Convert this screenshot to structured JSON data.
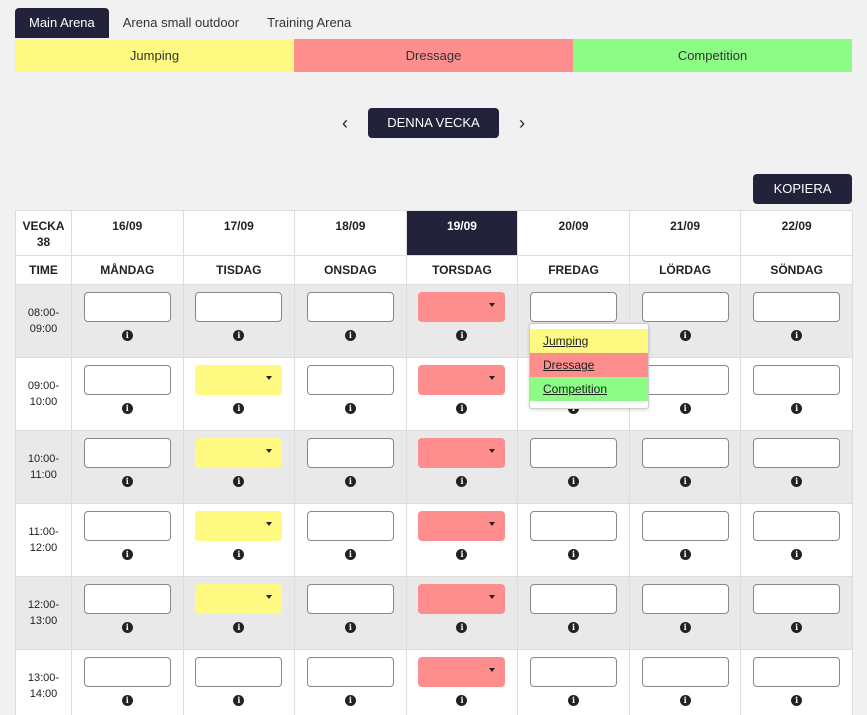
{
  "tabs": [
    {
      "label": "Main Arena",
      "active": true
    },
    {
      "label": "Arena small outdoor",
      "active": false
    },
    {
      "label": "Training Arena",
      "active": false
    }
  ],
  "legend": [
    {
      "label": "Jumping",
      "color": "#fef981"
    },
    {
      "label": "Dressage",
      "color": "#fe8d8d"
    },
    {
      "label": "Competition",
      "color": "#8cfc87"
    }
  ],
  "nav": {
    "prev_icon": "chevron-left-icon",
    "next_icon": "chevron-right-icon",
    "week_label": "DENNA VECKA"
  },
  "copy_label": "KOPIERA",
  "schedule": {
    "week_label_line1": "VECKA",
    "week_number": "38",
    "time_header": "TIME",
    "dates": [
      "16/09",
      "17/09",
      "18/09",
      "19/09",
      "20/09",
      "21/09",
      "22/09"
    ],
    "today_index": 3,
    "days": [
      "MÅNDAG",
      "TISDAG",
      "ONSDAG",
      "TORSDAG",
      "FREDAG",
      "LÖRDAG",
      "SÖNDAG"
    ],
    "info_glyph": "i",
    "slots": [
      {
        "start": "08:00-",
        "end": "09:00",
        "bookings": [
          "",
          "",
          "",
          "dressage",
          "",
          "",
          ""
        ]
      },
      {
        "start": "09:00-",
        "end": "10:00",
        "bookings": [
          "",
          "jumping",
          "",
          "dressage",
          "",
          "",
          ""
        ]
      },
      {
        "start": "10:00-",
        "end": "11:00",
        "bookings": [
          "",
          "jumping",
          "",
          "dressage",
          "",
          "",
          ""
        ]
      },
      {
        "start": "11:00-",
        "end": "12:00",
        "bookings": [
          "",
          "jumping",
          "",
          "dressage",
          "",
          "",
          ""
        ]
      },
      {
        "start": "12:00-",
        "end": "13:00",
        "bookings": [
          "",
          "jumping",
          "",
          "dressage",
          "",
          "",
          ""
        ]
      },
      {
        "start": "13:00-",
        "end": "14:00",
        "bookings": [
          "",
          "",
          "",
          "dressage",
          "",
          "",
          ""
        ]
      }
    ]
  },
  "dropdown": {
    "open_slot": {
      "slot": 0,
      "day": 4
    },
    "options": [
      {
        "label": "Jumping",
        "color": "#fef981"
      },
      {
        "label": "Dressage",
        "color": "#fe8d8d"
      },
      {
        "label": "Competition",
        "color": "#8cfc87"
      }
    ]
  }
}
